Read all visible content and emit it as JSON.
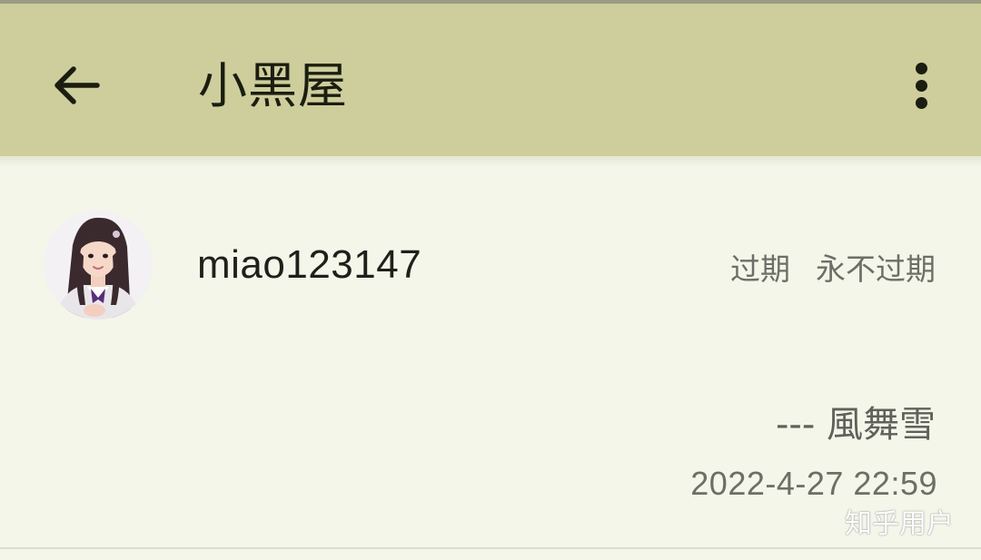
{
  "appbar": {
    "title": "小黑屋",
    "back_icon": "arrow-left-icon",
    "more_icon": "more-vert-icon",
    "background": "#cdce9c"
  },
  "entry": {
    "username": "miao123147",
    "expiry_label": "过期",
    "expiry_value": "永不过期",
    "signature": "--- 風舞雪",
    "timestamp": "2022-4-27 22:59"
  },
  "watermark": "知乎用户"
}
